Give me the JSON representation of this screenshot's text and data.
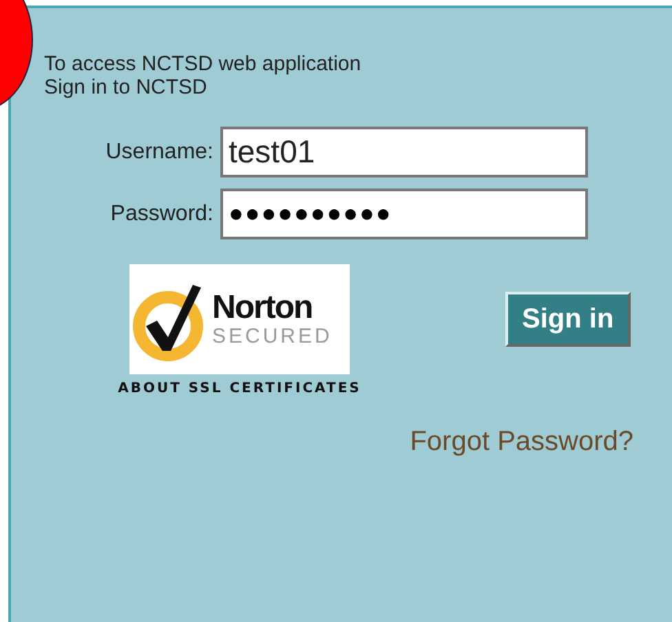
{
  "intro": [
    "To access NCTSD web application",
    "Sign in to NCTSD"
  ],
  "fields": [
    {
      "label": "Username:",
      "value": "test01"
    },
    {
      "label": "Password:",
      "value": "●●●●●●●●●●"
    }
  ],
  "badge": {
    "brand": "Norton",
    "subtitle": "SECURED",
    "link": "ABOUT SSL CERTIFICATES"
  },
  "sign_in_button": "Sign in",
  "forgot_link": "Forgot Password?"
}
